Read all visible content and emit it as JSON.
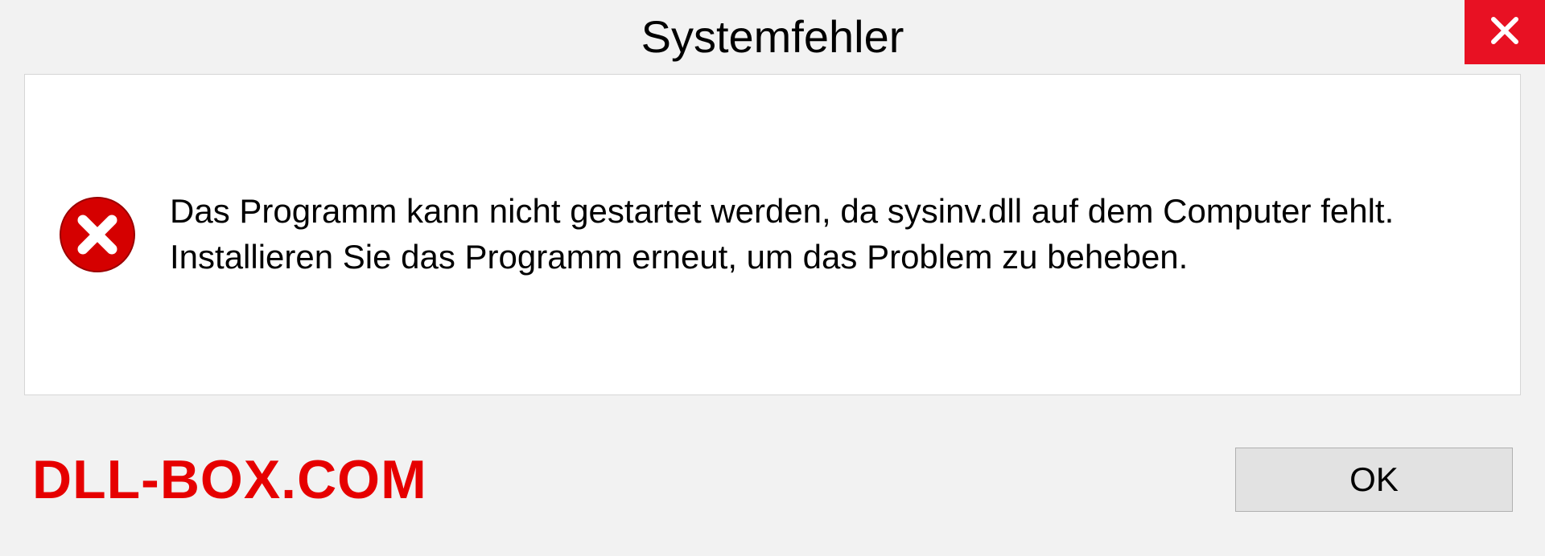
{
  "dialog": {
    "title": "Systemfehler",
    "message": "Das Programm kann nicht gestartet werden, da sysinv.dll auf dem Computer fehlt. Installieren Sie das Programm erneut, um das Problem zu beheben.",
    "ok_label": "OK"
  },
  "watermark": {
    "text": "DLL-BOX.COM"
  },
  "colors": {
    "close_bg": "#e81123",
    "error_icon": "#d50000",
    "watermark": "#e60000"
  }
}
